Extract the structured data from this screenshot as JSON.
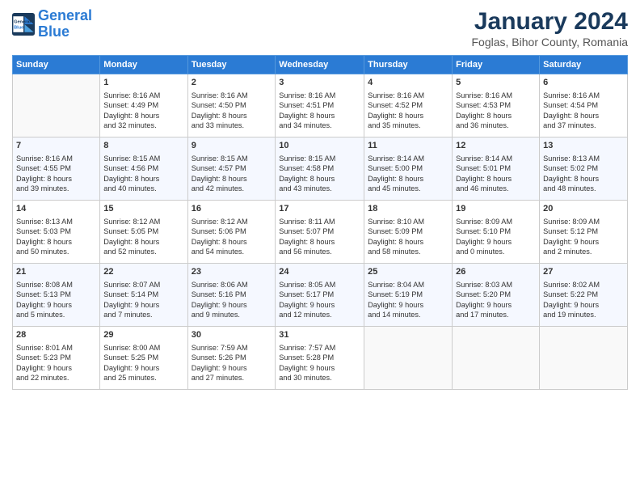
{
  "header": {
    "logo_line1": "General",
    "logo_line2": "Blue",
    "month": "January 2024",
    "location": "Foglas, Bihor County, Romania"
  },
  "weekdays": [
    "Sunday",
    "Monday",
    "Tuesday",
    "Wednesday",
    "Thursday",
    "Friday",
    "Saturday"
  ],
  "weeks": [
    [
      {
        "day": "",
        "info": ""
      },
      {
        "day": "1",
        "info": "Sunrise: 8:16 AM\nSunset: 4:49 PM\nDaylight: 8 hours\nand 32 minutes."
      },
      {
        "day": "2",
        "info": "Sunrise: 8:16 AM\nSunset: 4:50 PM\nDaylight: 8 hours\nand 33 minutes."
      },
      {
        "day": "3",
        "info": "Sunrise: 8:16 AM\nSunset: 4:51 PM\nDaylight: 8 hours\nand 34 minutes."
      },
      {
        "day": "4",
        "info": "Sunrise: 8:16 AM\nSunset: 4:52 PM\nDaylight: 8 hours\nand 35 minutes."
      },
      {
        "day": "5",
        "info": "Sunrise: 8:16 AM\nSunset: 4:53 PM\nDaylight: 8 hours\nand 36 minutes."
      },
      {
        "day": "6",
        "info": "Sunrise: 8:16 AM\nSunset: 4:54 PM\nDaylight: 8 hours\nand 37 minutes."
      }
    ],
    [
      {
        "day": "7",
        "info": "Sunrise: 8:16 AM\nSunset: 4:55 PM\nDaylight: 8 hours\nand 39 minutes."
      },
      {
        "day": "8",
        "info": "Sunrise: 8:15 AM\nSunset: 4:56 PM\nDaylight: 8 hours\nand 40 minutes."
      },
      {
        "day": "9",
        "info": "Sunrise: 8:15 AM\nSunset: 4:57 PM\nDaylight: 8 hours\nand 42 minutes."
      },
      {
        "day": "10",
        "info": "Sunrise: 8:15 AM\nSunset: 4:58 PM\nDaylight: 8 hours\nand 43 minutes."
      },
      {
        "day": "11",
        "info": "Sunrise: 8:14 AM\nSunset: 5:00 PM\nDaylight: 8 hours\nand 45 minutes."
      },
      {
        "day": "12",
        "info": "Sunrise: 8:14 AM\nSunset: 5:01 PM\nDaylight: 8 hours\nand 46 minutes."
      },
      {
        "day": "13",
        "info": "Sunrise: 8:13 AM\nSunset: 5:02 PM\nDaylight: 8 hours\nand 48 minutes."
      }
    ],
    [
      {
        "day": "14",
        "info": "Sunrise: 8:13 AM\nSunset: 5:03 PM\nDaylight: 8 hours\nand 50 minutes."
      },
      {
        "day": "15",
        "info": "Sunrise: 8:12 AM\nSunset: 5:05 PM\nDaylight: 8 hours\nand 52 minutes."
      },
      {
        "day": "16",
        "info": "Sunrise: 8:12 AM\nSunset: 5:06 PM\nDaylight: 8 hours\nand 54 minutes."
      },
      {
        "day": "17",
        "info": "Sunrise: 8:11 AM\nSunset: 5:07 PM\nDaylight: 8 hours\nand 56 minutes."
      },
      {
        "day": "18",
        "info": "Sunrise: 8:10 AM\nSunset: 5:09 PM\nDaylight: 8 hours\nand 58 minutes."
      },
      {
        "day": "19",
        "info": "Sunrise: 8:09 AM\nSunset: 5:10 PM\nDaylight: 9 hours\nand 0 minutes."
      },
      {
        "day": "20",
        "info": "Sunrise: 8:09 AM\nSunset: 5:12 PM\nDaylight: 9 hours\nand 2 minutes."
      }
    ],
    [
      {
        "day": "21",
        "info": "Sunrise: 8:08 AM\nSunset: 5:13 PM\nDaylight: 9 hours\nand 5 minutes."
      },
      {
        "day": "22",
        "info": "Sunrise: 8:07 AM\nSunset: 5:14 PM\nDaylight: 9 hours\nand 7 minutes."
      },
      {
        "day": "23",
        "info": "Sunrise: 8:06 AM\nSunset: 5:16 PM\nDaylight: 9 hours\nand 9 minutes."
      },
      {
        "day": "24",
        "info": "Sunrise: 8:05 AM\nSunset: 5:17 PM\nDaylight: 9 hours\nand 12 minutes."
      },
      {
        "day": "25",
        "info": "Sunrise: 8:04 AM\nSunset: 5:19 PM\nDaylight: 9 hours\nand 14 minutes."
      },
      {
        "day": "26",
        "info": "Sunrise: 8:03 AM\nSunset: 5:20 PM\nDaylight: 9 hours\nand 17 minutes."
      },
      {
        "day": "27",
        "info": "Sunrise: 8:02 AM\nSunset: 5:22 PM\nDaylight: 9 hours\nand 19 minutes."
      }
    ],
    [
      {
        "day": "28",
        "info": "Sunrise: 8:01 AM\nSunset: 5:23 PM\nDaylight: 9 hours\nand 22 minutes."
      },
      {
        "day": "29",
        "info": "Sunrise: 8:00 AM\nSunset: 5:25 PM\nDaylight: 9 hours\nand 25 minutes."
      },
      {
        "day": "30",
        "info": "Sunrise: 7:59 AM\nSunset: 5:26 PM\nDaylight: 9 hours\nand 27 minutes."
      },
      {
        "day": "31",
        "info": "Sunrise: 7:57 AM\nSunset: 5:28 PM\nDaylight: 9 hours\nand 30 minutes."
      },
      {
        "day": "",
        "info": ""
      },
      {
        "day": "",
        "info": ""
      },
      {
        "day": "",
        "info": ""
      }
    ]
  ]
}
